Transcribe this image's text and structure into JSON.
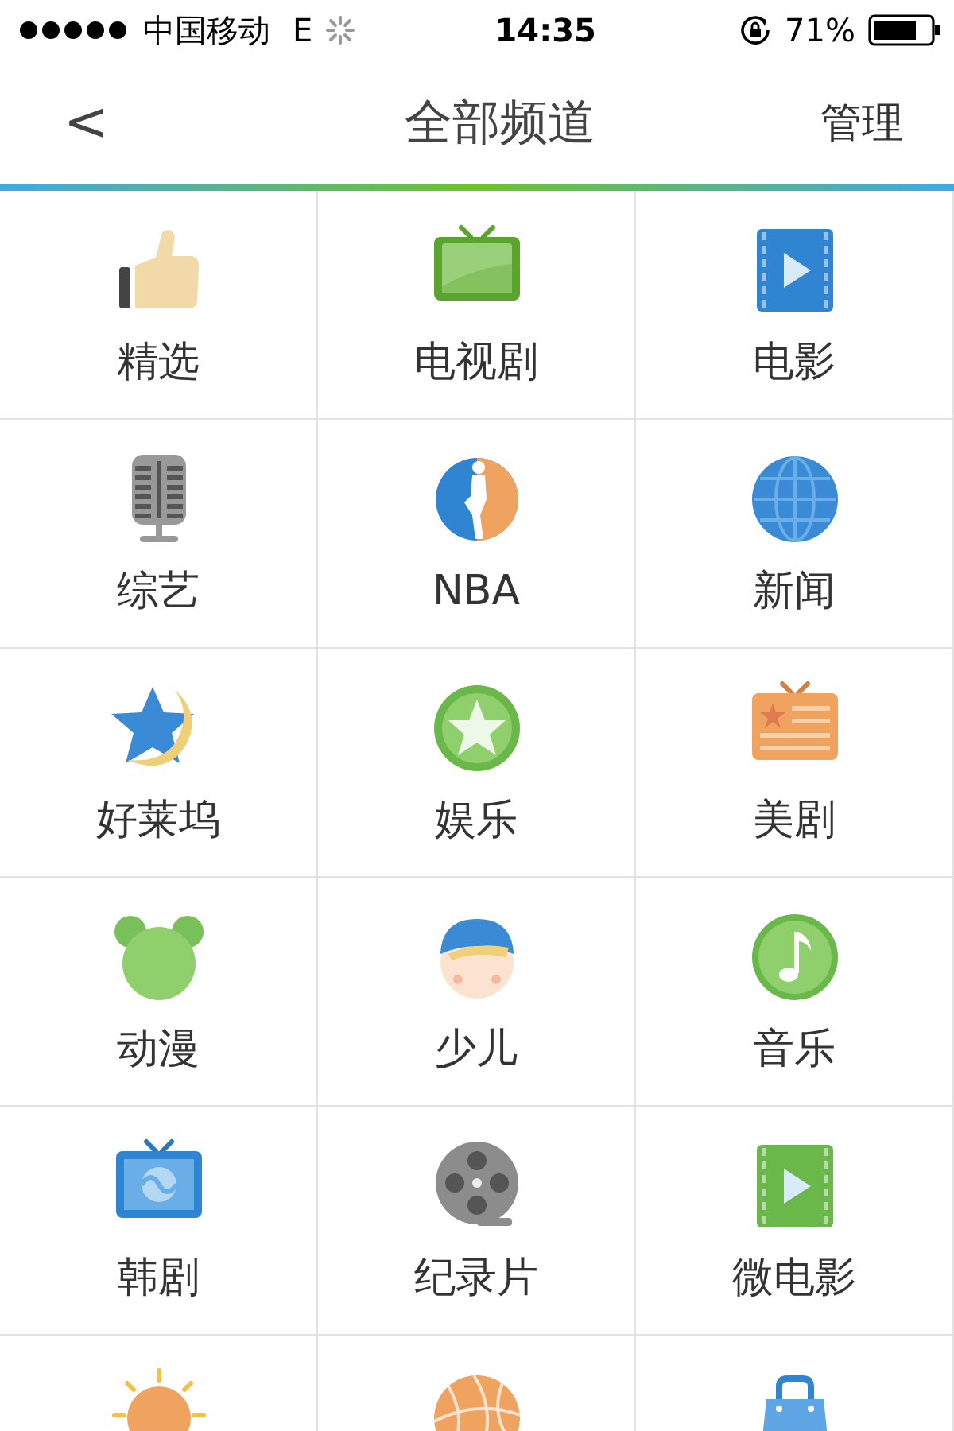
{
  "status_bar": {
    "carrier": "中国移动",
    "network": "E",
    "time": "14:35",
    "battery": "71%"
  },
  "nav": {
    "back": "<",
    "title": "全部频道",
    "action": "管理"
  },
  "channels": [
    {
      "kind": "thumb",
      "label": "精选"
    },
    {
      "kind": "tv",
      "label": "电视剧"
    },
    {
      "kind": "film",
      "label": "电影"
    },
    {
      "kind": "mic",
      "label": "综艺"
    },
    {
      "kind": "player",
      "label": "NBA"
    },
    {
      "kind": "globe",
      "label": "新闻"
    },
    {
      "kind": "starmoon",
      "label": "好莱坞"
    },
    {
      "kind": "star",
      "label": "娱乐"
    },
    {
      "kind": "flagtv",
      "label": "美剧"
    },
    {
      "kind": "bear",
      "label": "动漫"
    },
    {
      "kind": "kid",
      "label": "少儿"
    },
    {
      "kind": "note",
      "label": "音乐"
    },
    {
      "kind": "bluetv",
      "label": "韩剧"
    },
    {
      "kind": "reel",
      "label": "纪录片"
    },
    {
      "kind": "greenfilm",
      "label": "微电影"
    },
    {
      "kind": "sun"
    },
    {
      "kind": "ball"
    },
    {
      "kind": "bag"
    }
  ]
}
